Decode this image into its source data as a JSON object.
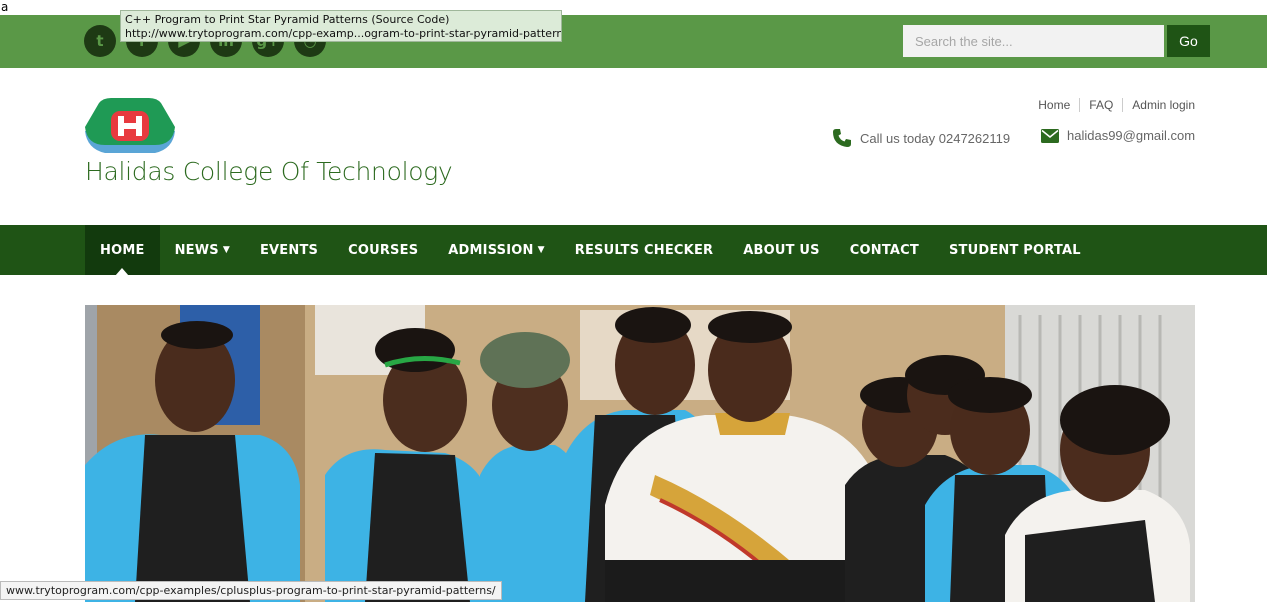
{
  "page_char": "a",
  "tooltip": {
    "title": "C++ Program to Print Star Pyramid Patterns (Source Code)",
    "url": "http://www.trytoprogram.com/cpp-examp...ogram-to-print-star-pyramid-patterns/"
  },
  "social": [
    {
      "name": "twitter",
      "glyph": "t"
    },
    {
      "name": "facebook",
      "glyph": "f"
    },
    {
      "name": "youtube",
      "glyph": "▶"
    },
    {
      "name": "linkedin",
      "glyph": "in"
    },
    {
      "name": "googleplus",
      "glyph": "g+"
    },
    {
      "name": "rss",
      "glyph": "◔"
    }
  ],
  "search": {
    "placeholder": "Search the site...",
    "button": "Go"
  },
  "site": {
    "title": "Halidas College Of Technology"
  },
  "util_links": [
    "Home",
    "FAQ",
    "Admin login"
  ],
  "contact": {
    "phone": "Call us today 0247262119",
    "email": "halidas99@gmail.com"
  },
  "nav": [
    {
      "label": "HOME",
      "active": true
    },
    {
      "label": "NEWS",
      "dropdown": true
    },
    {
      "label": "EVENTS"
    },
    {
      "label": "COURSES"
    },
    {
      "label": "ADMISSION",
      "dropdown": true
    },
    {
      "label": "RESULTS CHECKER"
    },
    {
      "label": "ABOUT US"
    },
    {
      "label": "CONTACT"
    },
    {
      "label": "STUDENT PORTAL"
    }
  ],
  "status_url": "www.trytoprogram.com/cpp-examples/cplusplus-program-to-print-star-pyramid-patterns/",
  "colors": {
    "topbar": "#5a9847",
    "navbar": "#1f5415",
    "nav_active": "#123a0d",
    "title": "#2c6a1f"
  }
}
